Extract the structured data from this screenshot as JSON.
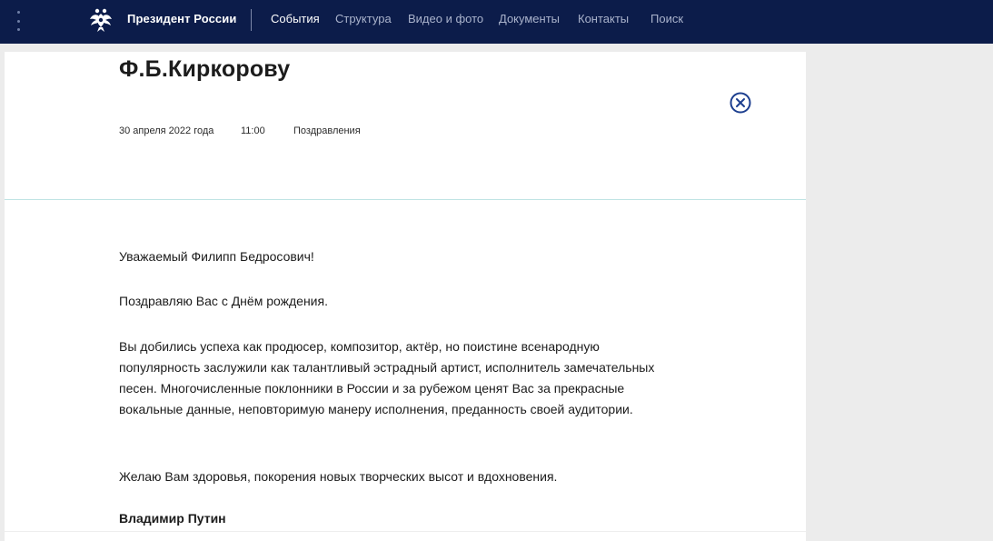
{
  "header": {
    "brand": "Президент России",
    "nav": [
      "События",
      "Структура",
      "Видео и фото",
      "Документы",
      "Контакты",
      "Поиск"
    ],
    "active_nav": "События",
    "colors": {
      "background": "#0c1c4a",
      "text": "#ffffff",
      "text_muted": "#aab3cc"
    }
  },
  "article": {
    "title": "Ф.Б.Киркорову",
    "date": "30 апреля 2022 года",
    "time": "11:00",
    "category": "Поздравления",
    "paragraphs": [
      "Уважаемый Филипп Бедросович!",
      "Поздравляю Вас с Днём рождения.",
      "Вы добились успеха как продюсер, композитор, актёр, но поистине всенародную популярность заслужили как талантливый эстрадный артист, исполнитель замечательных песен. Многочисленные поклонники в России и за рубежом ценят Вас за прекрасные вокальные данные, неповторимую манеру исполнения, преданность своей аудитории.",
      "Желаю Вам здоровья, покорения новых творческих высот и вдохновения."
    ],
    "signature": "Владимир Путин"
  },
  "icons": {
    "menu": "kebab-menu-icon",
    "emblem": "double-headed-eagle-emblem",
    "close": "close-circle-icon"
  },
  "colors": {
    "accent": "#1d3f8f",
    "divider": "#bfe3e3",
    "page_bg": "#ececec"
  }
}
